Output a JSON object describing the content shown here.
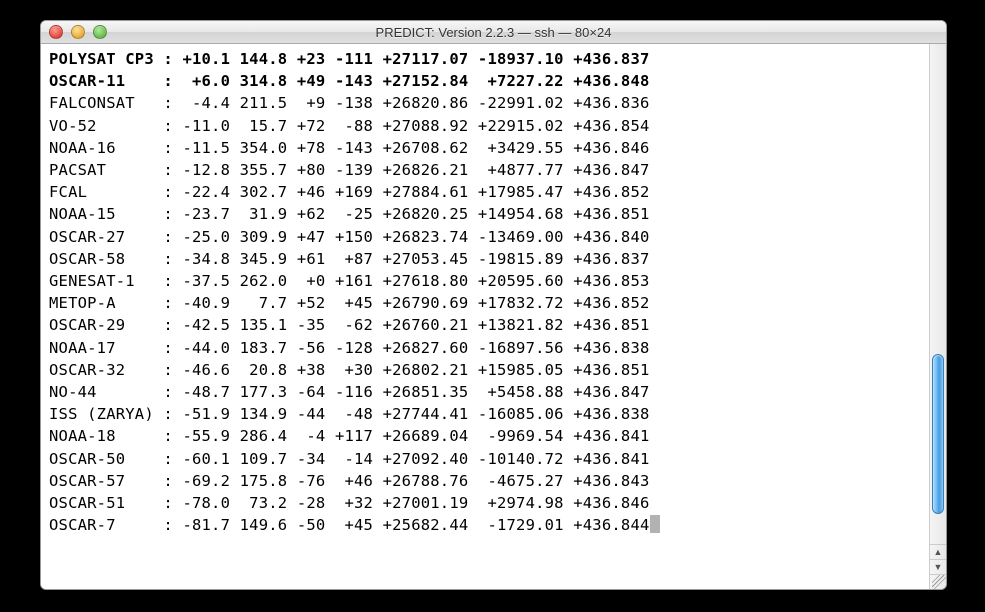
{
  "window": {
    "title": "PREDICT: Version 2.2.3 — ssh — 80×24"
  },
  "rows": [
    {
      "bold": true,
      "name": "POLYSAT CP3",
      "sep": ":",
      "c1": "+10.1",
      "c2": "144.8",
      "c3": "+23",
      "c4": "-111",
      "c5": "+27117.07",
      "c6": "-18937.10",
      "c7": "+436.837"
    },
    {
      "bold": true,
      "name": "OSCAR-11",
      "sep": ":",
      "c1": "+6.0",
      "c2": "314.8",
      "c3": "+49",
      "c4": "-143",
      "c5": "+27152.84",
      "c6": "+7227.22",
      "c7": "+436.848"
    },
    {
      "bold": false,
      "name": "FALCONSAT",
      "sep": ":",
      "c1": "-4.4",
      "c2": "211.5",
      "c3": "+9",
      "c4": "-138",
      "c5": "+26820.86",
      "c6": "-22991.02",
      "c7": "+436.836"
    },
    {
      "bold": false,
      "name": "VO-52",
      "sep": ":",
      "c1": "-11.0",
      "c2": "15.7",
      "c3": "+72",
      "c4": "-88",
      "c5": "+27088.92",
      "c6": "+22915.02",
      "c7": "+436.854"
    },
    {
      "bold": false,
      "name": "NOAA-16",
      "sep": ":",
      "c1": "-11.5",
      "c2": "354.0",
      "c3": "+78",
      "c4": "-143",
      "c5": "+26708.62",
      "c6": "+3429.55",
      "c7": "+436.846"
    },
    {
      "bold": false,
      "name": "PACSAT",
      "sep": ":",
      "c1": "-12.8",
      "c2": "355.7",
      "c3": "+80",
      "c4": "-139",
      "c5": "+26826.21",
      "c6": "+4877.77",
      "c7": "+436.847"
    },
    {
      "bold": false,
      "name": "FCAL",
      "sep": ":",
      "c1": "-22.4",
      "c2": "302.7",
      "c3": "+46",
      "c4": "+169",
      "c5": "+27884.61",
      "c6": "+17985.47",
      "c7": "+436.852"
    },
    {
      "bold": false,
      "name": "NOAA-15",
      "sep": ":",
      "c1": "-23.7",
      "c2": "31.9",
      "c3": "+62",
      "c4": "-25",
      "c5": "+26820.25",
      "c6": "+14954.68",
      "c7": "+436.851"
    },
    {
      "bold": false,
      "name": "OSCAR-27",
      "sep": ":",
      "c1": "-25.0",
      "c2": "309.9",
      "c3": "+47",
      "c4": "+150",
      "c5": "+26823.74",
      "c6": "-13469.00",
      "c7": "+436.840"
    },
    {
      "bold": false,
      "name": "OSCAR-58",
      "sep": ":",
      "c1": "-34.8",
      "c2": "345.9",
      "c3": "+61",
      "c4": "+87",
      "c5": "+27053.45",
      "c6": "-19815.89",
      "c7": "+436.837"
    },
    {
      "bold": false,
      "name": "GENESAT-1",
      "sep": ":",
      "c1": "-37.5",
      "c2": "262.0",
      "c3": "+0",
      "c4": "+161",
      "c5": "+27618.80",
      "c6": "+20595.60",
      "c7": "+436.853"
    },
    {
      "bold": false,
      "name": "METOP-A",
      "sep": ":",
      "c1": "-40.9",
      "c2": "7.7",
      "c3": "+52",
      "c4": "+45",
      "c5": "+26790.69",
      "c6": "+17832.72",
      "c7": "+436.852"
    },
    {
      "bold": false,
      "name": "OSCAR-29",
      "sep": ":",
      "c1": "-42.5",
      "c2": "135.1",
      "c3": "-35",
      "c4": "-62",
      "c5": "+26760.21",
      "c6": "+13821.82",
      "c7": "+436.851"
    },
    {
      "bold": false,
      "name": "NOAA-17",
      "sep": ":",
      "c1": "-44.0",
      "c2": "183.7",
      "c3": "-56",
      "c4": "-128",
      "c5": "+26827.60",
      "c6": "-16897.56",
      "c7": "+436.838"
    },
    {
      "bold": false,
      "name": "OSCAR-32",
      "sep": ":",
      "c1": "-46.6",
      "c2": "20.8",
      "c3": "+38",
      "c4": "+30",
      "c5": "+26802.21",
      "c6": "+15985.05",
      "c7": "+436.851"
    },
    {
      "bold": false,
      "name": "NO-44",
      "sep": ":",
      "c1": "-48.7",
      "c2": "177.3",
      "c3": "-64",
      "c4": "-116",
      "c5": "+26851.35",
      "c6": "+5458.88",
      "c7": "+436.847"
    },
    {
      "bold": false,
      "name": "ISS (ZARYA)",
      "sep": ":",
      "c1": "-51.9",
      "c2": "134.9",
      "c3": "-44",
      "c4": "-48",
      "c5": "+27744.41",
      "c6": "-16085.06",
      "c7": "+436.838"
    },
    {
      "bold": false,
      "name": "NOAA-18",
      "sep": ":",
      "c1": "-55.9",
      "c2": "286.4",
      "c3": "-4",
      "c4": "+117",
      "c5": "+26689.04",
      "c6": "-9969.54",
      "c7": "+436.841"
    },
    {
      "bold": false,
      "name": "OSCAR-50",
      "sep": ":",
      "c1": "-60.1",
      "c2": "109.7",
      "c3": "-34",
      "c4": "-14",
      "c5": "+27092.40",
      "c6": "-10140.72",
      "c7": "+436.841"
    },
    {
      "bold": false,
      "name": "OSCAR-57",
      "sep": ":",
      "c1": "-69.2",
      "c2": "175.8",
      "c3": "-76",
      "c4": "+46",
      "c5": "+26788.76",
      "c6": "-4675.27",
      "c7": "+436.843"
    },
    {
      "bold": false,
      "name": "OSCAR-51",
      "sep": ":",
      "c1": "-78.0",
      "c2": "73.2",
      "c3": "-28",
      "c4": "+32",
      "c5": "+27001.19",
      "c6": "+2974.98",
      "c7": "+436.846"
    },
    {
      "bold": false,
      "name": "OSCAR-7",
      "sep": ":",
      "c1": "-81.7",
      "c2": "149.6",
      "c3": "-50",
      "c4": "+45",
      "c5": "+25682.44",
      "c6": "-1729.01",
      "c7": "+436.844"
    }
  ]
}
